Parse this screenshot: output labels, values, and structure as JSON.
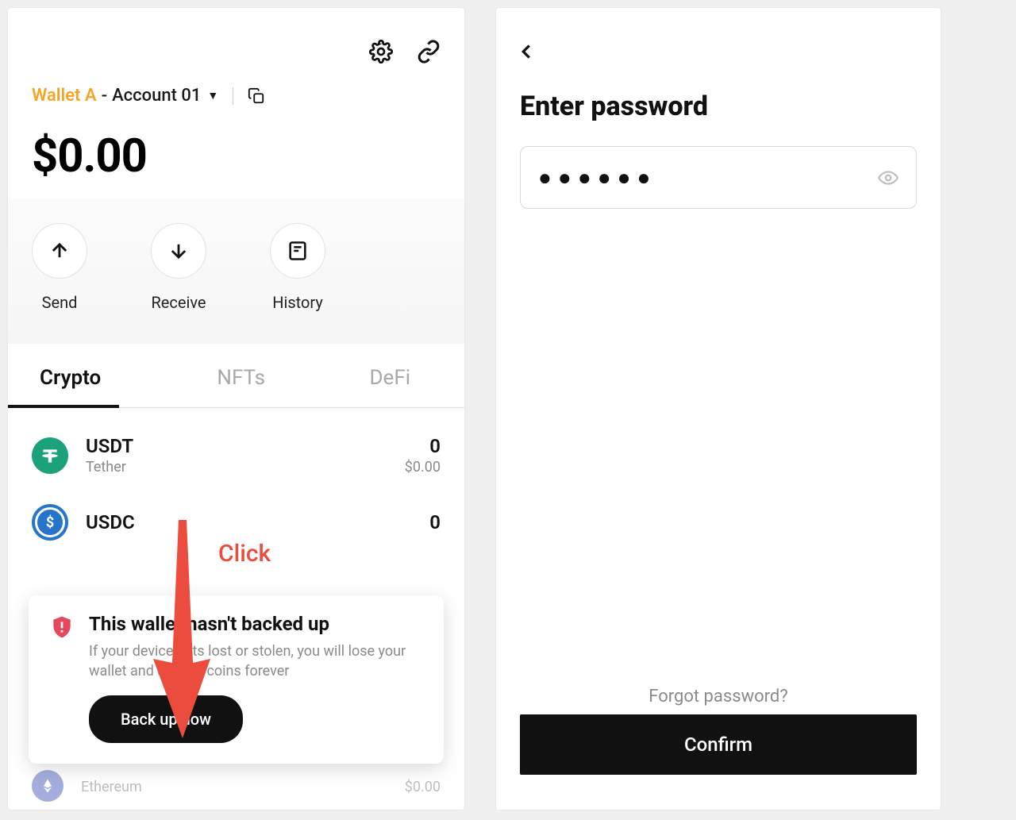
{
  "left": {
    "wallet_name": "Wallet A",
    "account_name": "Account 01",
    "balance": "$0.00",
    "actions": {
      "send": "Send",
      "receive": "Receive",
      "history": "History"
    },
    "tabs": {
      "crypto": "Crypto",
      "nfts": "NFTs",
      "defi": "DeFi"
    },
    "assets": [
      {
        "symbol": "USDT",
        "name": "Tether",
        "qty": "0",
        "fiat": "$0.00",
        "color": "#1ba27a"
      },
      {
        "symbol": "USDC",
        "name": "",
        "qty": "0",
        "fiat": "",
        "color": "#2775ca"
      }
    ],
    "faded_asset": {
      "name": "Ethereum",
      "fiat": "$0.00"
    },
    "backup": {
      "title": "This wallet hasn't backed up",
      "desc": "If your device gets lost or stolen, you will lose your wallet and all your coins forever",
      "button": "Back up now"
    },
    "annotation": "Click"
  },
  "right": {
    "title": "Enter password",
    "password_mask": "●●●●●●",
    "forgot": "Forgot password?",
    "confirm": "Confirm"
  }
}
